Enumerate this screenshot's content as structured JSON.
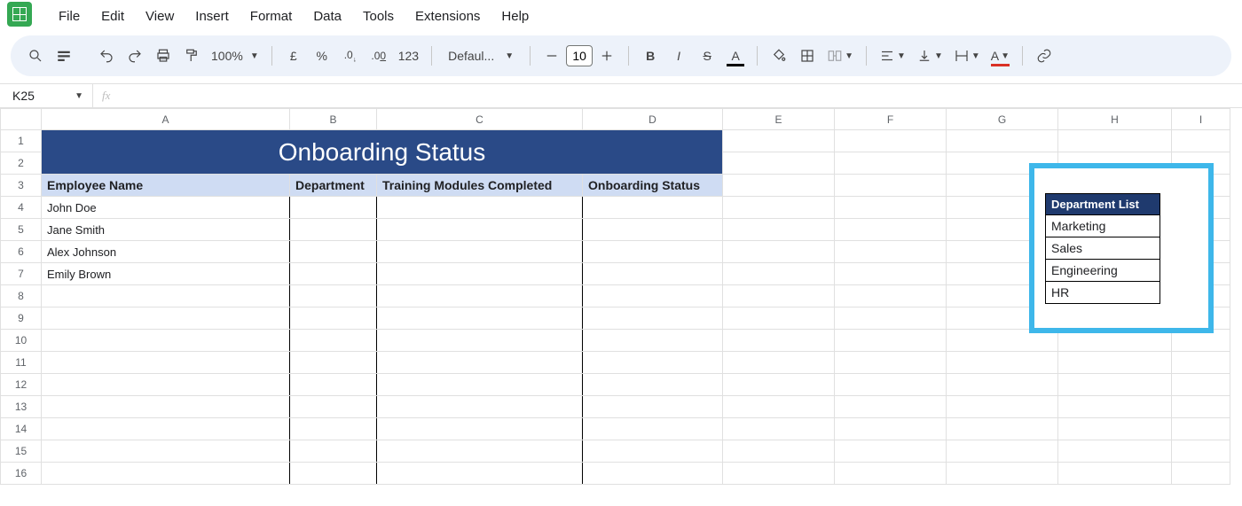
{
  "menu": {
    "items": [
      "File",
      "Edit",
      "View",
      "Insert",
      "Format",
      "Data",
      "Tools",
      "Extensions",
      "Help"
    ]
  },
  "toolbar": {
    "zoom": "100%",
    "currency": "£",
    "percent": "%",
    "dec_dec": ".0",
    "inc_dec": ".00",
    "numfmt": "123",
    "font": "Defaul...",
    "fontsize": "10"
  },
  "namebox": "K25",
  "formula": "",
  "columns": [
    "A",
    "B",
    "C",
    "D",
    "E",
    "F",
    "G",
    "H",
    "I"
  ],
  "row_count": 16,
  "sheet": {
    "title": "Onboarding Status",
    "headers": [
      "Employee Name",
      "Department",
      "Training Modules Completed",
      "Onboarding Status"
    ],
    "employees": [
      {
        "name": "John Doe"
      },
      {
        "name": "Jane Smith"
      },
      {
        "name": "Alex Johnson"
      },
      {
        "name": "Emily Brown"
      }
    ]
  },
  "department_list": {
    "header": "Department List",
    "items": [
      "Marketing",
      "Sales",
      "Engineering",
      "HR"
    ]
  }
}
